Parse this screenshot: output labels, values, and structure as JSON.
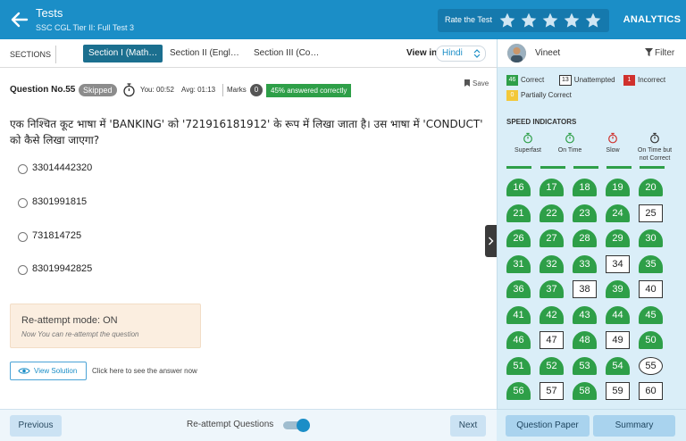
{
  "header": {
    "title": "Tests",
    "subtitle": "SSC CGL Tier II: Full Test 3",
    "rate_label": "Rate the Test",
    "analytics_label": "ANALYTICS"
  },
  "sections": {
    "label": "SECTIONS",
    "tabs": [
      {
        "label": "Section I (Math…",
        "active": true
      },
      {
        "label": "Section II (Engl…",
        "active": false
      },
      {
        "label": "Section III (Co…",
        "active": false
      }
    ],
    "view_in_label": "View in",
    "language": "Hindi"
  },
  "question": {
    "number_label": "Question No.55",
    "status": "Skipped",
    "you_time": "You: 00:52",
    "avg_time": "Avg: 01:13",
    "marks_label": "Marks",
    "marks_value": "0",
    "answered_pct": "45% answered correctly",
    "save_label": "Save",
    "text": "एक निश्चित कूट भाषा में 'BANKING' को '721916181912' के रूप में लिखा जाता है। उस भाषा में 'CONDUCT' को कैसे लिखा जाएगा?",
    "options": [
      "33014442320",
      "8301991815",
      "731814725",
      "83019942825"
    ]
  },
  "reattempt": {
    "title": "Re-attempt mode: ON",
    "subtitle": "Now You can re-attempt the question"
  },
  "solution": {
    "button_label": "View Solution",
    "hint": "Click here to see the answer now"
  },
  "user": {
    "name": "Vineet",
    "filter_label": "Filter"
  },
  "legend": {
    "correct_count": "46",
    "correct_label": "Correct",
    "unattempted_count": "13",
    "unattempted_label": "Unattempted",
    "incorrect_count": "1",
    "incorrect_label": "Incorrect",
    "partial_count": "0",
    "partial_label": "Partially Correct"
  },
  "speed": {
    "title": "SPEED INDICATORS",
    "items": [
      "Superfast",
      "On Time",
      "Slow",
      "On Time but not Correct"
    ],
    "colors": [
      "#2e9f48",
      "#2e9f48",
      "#d0312d",
      "#333333"
    ]
  },
  "questions_grid": [
    {
      "n": "16",
      "s": "correct"
    },
    {
      "n": "17",
      "s": "correct"
    },
    {
      "n": "18",
      "s": "correct"
    },
    {
      "n": "19",
      "s": "correct"
    },
    {
      "n": "20",
      "s": "correct"
    },
    {
      "n": "21",
      "s": "correct"
    },
    {
      "n": "22",
      "s": "correct"
    },
    {
      "n": "23",
      "s": "correct"
    },
    {
      "n": "24",
      "s": "correct"
    },
    {
      "n": "25",
      "s": "unattempted"
    },
    {
      "n": "26",
      "s": "correct"
    },
    {
      "n": "27",
      "s": "correct"
    },
    {
      "n": "28",
      "s": "correct"
    },
    {
      "n": "29",
      "s": "correct"
    },
    {
      "n": "30",
      "s": "correct"
    },
    {
      "n": "31",
      "s": "correct"
    },
    {
      "n": "32",
      "s": "correct"
    },
    {
      "n": "33",
      "s": "correct"
    },
    {
      "n": "34",
      "s": "unattempted"
    },
    {
      "n": "35",
      "s": "correct"
    },
    {
      "n": "36",
      "s": "correct"
    },
    {
      "n": "37",
      "s": "correct"
    },
    {
      "n": "38",
      "s": "unattempted"
    },
    {
      "n": "39",
      "s": "correct"
    },
    {
      "n": "40",
      "s": "unattempted"
    },
    {
      "n": "41",
      "s": "correct"
    },
    {
      "n": "42",
      "s": "correct"
    },
    {
      "n": "43",
      "s": "correct"
    },
    {
      "n": "44",
      "s": "correct"
    },
    {
      "n": "45",
      "s": "correct"
    },
    {
      "n": "46",
      "s": "correct"
    },
    {
      "n": "47",
      "s": "unattempted"
    },
    {
      "n": "48",
      "s": "correct"
    },
    {
      "n": "49",
      "s": "unattempted"
    },
    {
      "n": "50",
      "s": "correct"
    },
    {
      "n": "51",
      "s": "correct"
    },
    {
      "n": "52",
      "s": "correct"
    },
    {
      "n": "53",
      "s": "correct"
    },
    {
      "n": "54",
      "s": "correct"
    },
    {
      "n": "55",
      "s": "current"
    },
    {
      "n": "56",
      "s": "correct"
    },
    {
      "n": "57",
      "s": "unattempted"
    },
    {
      "n": "58",
      "s": "correct"
    },
    {
      "n": "59",
      "s": "unattempted"
    },
    {
      "n": "60",
      "s": "unattempted"
    }
  ],
  "footer": {
    "previous_label": "Previous",
    "reattempt_questions_label": "Re-attempt Questions",
    "next_label": "Next",
    "question_paper_label": "Question Paper",
    "summary_label": "Summary"
  },
  "colors": {
    "header": "#1b8ec7",
    "correct": "#2e9f48",
    "incorrect": "#d0312d",
    "partial": "#f3c83a"
  }
}
